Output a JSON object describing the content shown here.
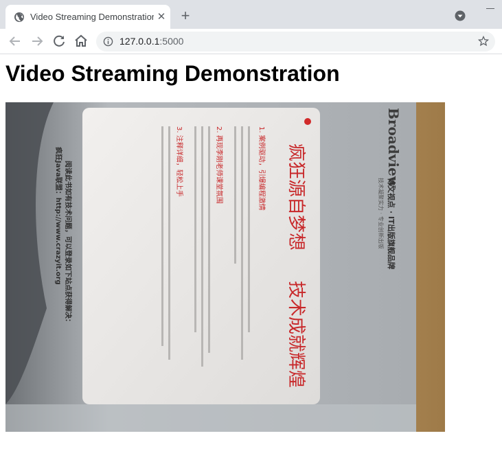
{
  "browser": {
    "tab": {
      "title": "Video Streaming Demonstration"
    },
    "address_bar": {
      "host": "127.0.0.1",
      "rest": ":5000"
    }
  },
  "page": {
    "title": "Video Streaming Demonstration",
    "video": {
      "logo_text": "Broadview",
      "header_text": "博文视点 · IT出版旗舰品牌",
      "header_sub": "技术凝聚实力 · 专业创新出版",
      "heading_line1": "疯狂源自梦想",
      "heading_line2": "技术成就辉煌",
      "section1_title": "1. 案例驱动，引爆编程激情",
      "section2_title": "2. 再现李刚老师课堂氛围",
      "section3_title": "3. 注释详细，轻松上手",
      "footer_line1": "阅读此书如有技术问题，可以登录如下站点获得解决：",
      "footer_line2": "疯狂Java联盟：http://www.crazyit.org"
    }
  },
  "colors": {
    "tabstrip": "#dee1e6",
    "omnibox": "#f1f3f4",
    "accent_red": "#c8282a"
  }
}
